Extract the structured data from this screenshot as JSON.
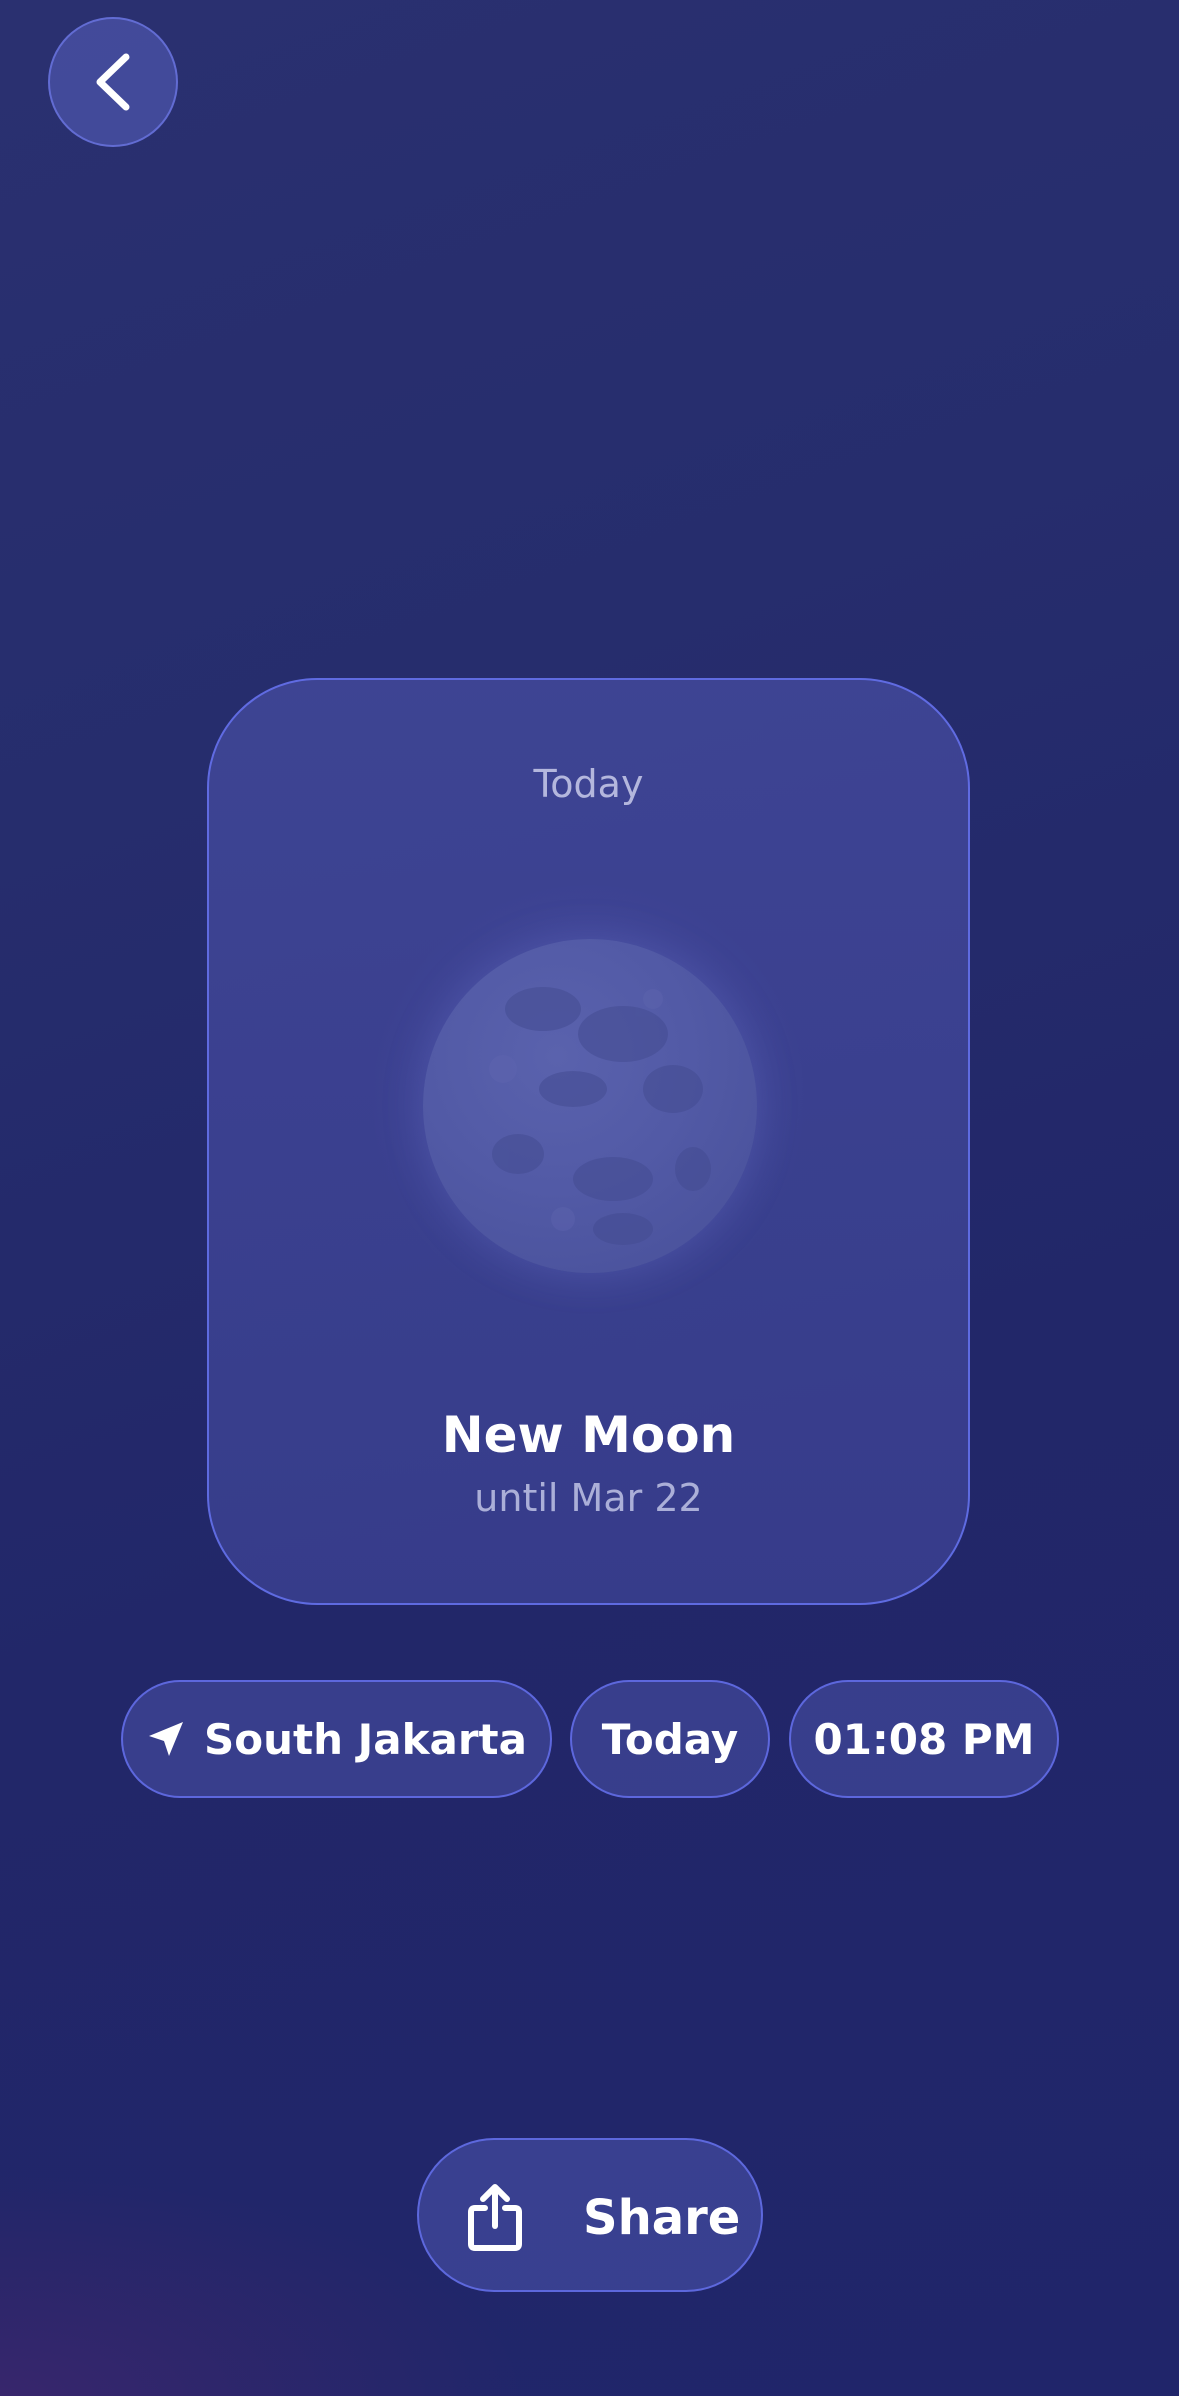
{
  "header": {
    "back_icon": "chevron-left-icon"
  },
  "card": {
    "label": "Today",
    "moon_icon": "moon-image",
    "phase_name": "New Moon",
    "phase_until": "until Mar 22"
  },
  "filters": {
    "location_icon": "location-arrow-icon",
    "location": "South Jakarta",
    "day": "Today",
    "time": "01:08 PM"
  },
  "actions": {
    "share_icon": "share-icon",
    "share_label": "Share"
  },
  "colors": {
    "background": "#232869",
    "accent_border": "#6470eb",
    "card_fill": "#3f4592"
  }
}
